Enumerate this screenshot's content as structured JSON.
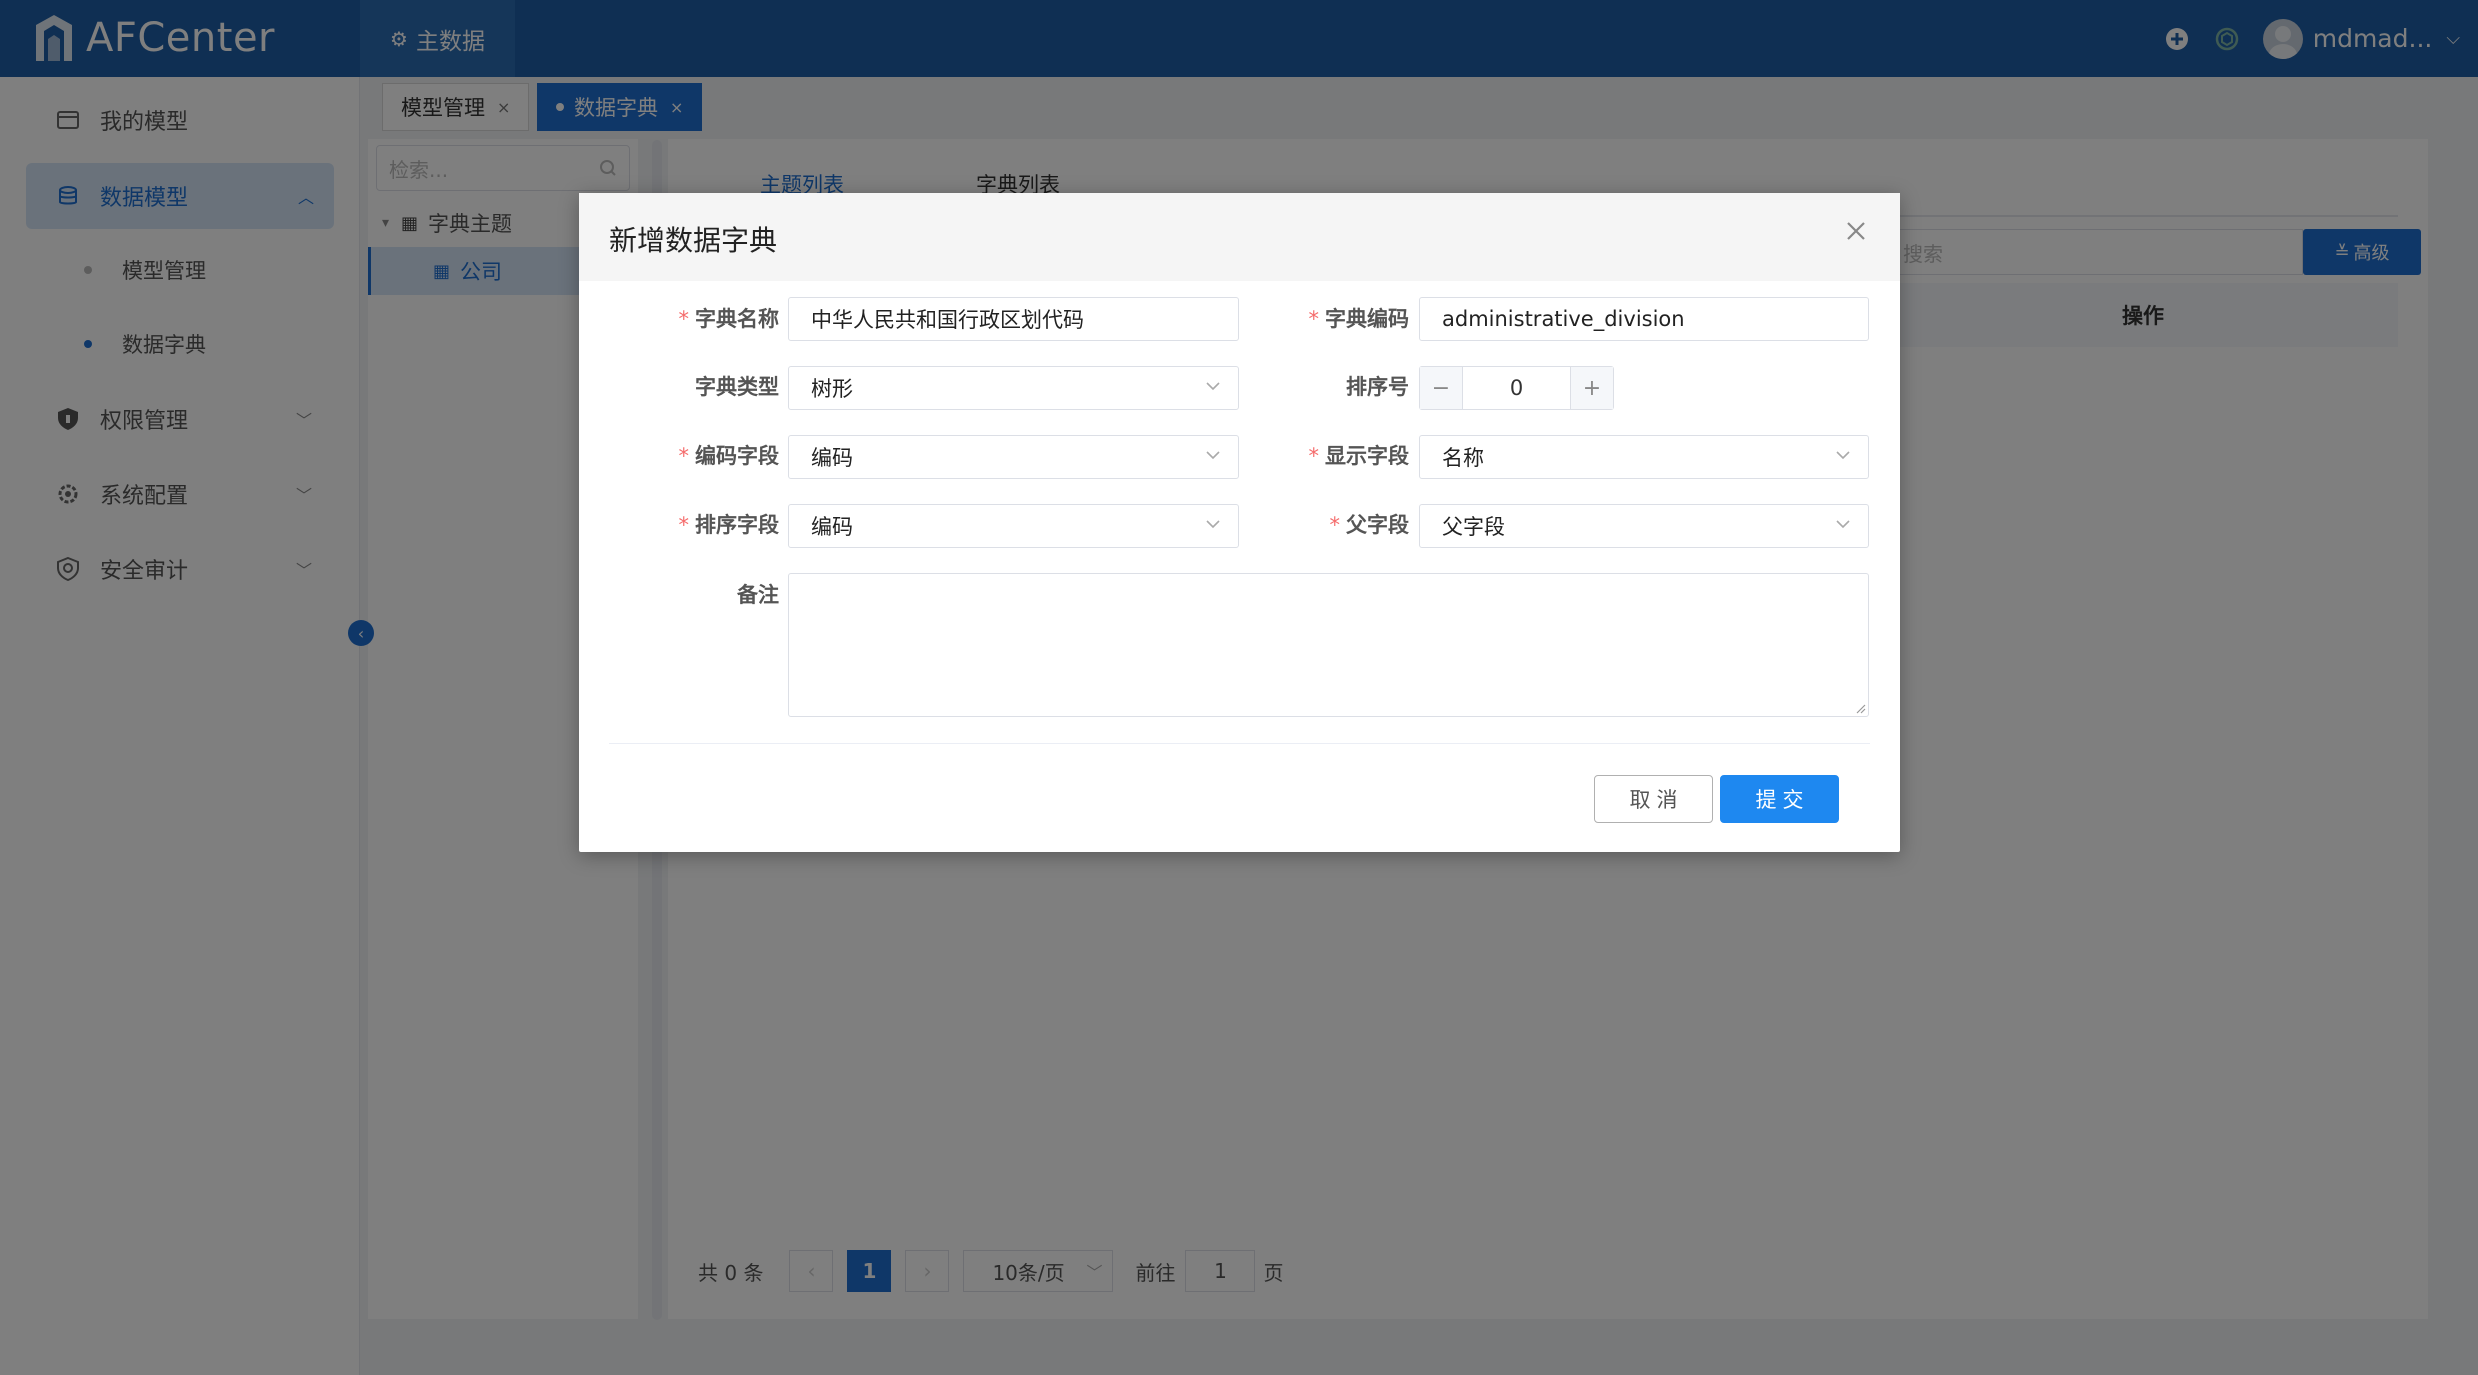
{
  "app": {
    "logo_text": "AFCenter",
    "top_nav_label": "主数据",
    "username": "mdmad..."
  },
  "sidebar": {
    "items": [
      {
        "label": "我的模型"
      },
      {
        "label": "数据模型"
      },
      {
        "label": "权限管理"
      },
      {
        "label": "系统配置"
      },
      {
        "label": "安全审计"
      }
    ],
    "subitems": [
      {
        "label": "模型管理"
      },
      {
        "label": "数据字典"
      }
    ]
  },
  "tabs": [
    {
      "label": "模型管理",
      "close": "×"
    },
    {
      "label": "数据字典",
      "close": "×"
    }
  ],
  "tree": {
    "search_placeholder": "检索...",
    "nodes": [
      {
        "label": "字典主题"
      },
      {
        "label": "公司"
      }
    ]
  },
  "main": {
    "tabs": [
      {
        "label": "主题列表"
      },
      {
        "label": "字典列表"
      }
    ],
    "search_placeholder": "搜索",
    "advanced_label": "高级",
    "column_operation": "操作",
    "pager": {
      "total": "共 0 条",
      "current_page": "1",
      "page_size": "10条/页",
      "goto_prefix": "前往",
      "goto_value": "1",
      "goto_suffix": "页"
    }
  },
  "modal": {
    "title": "新增数据字典",
    "fields": {
      "dict_name": {
        "label": "字典名称",
        "value": "中华人民共和国行政区划代码"
      },
      "dict_code": {
        "label": "字典编码",
        "value": "administrative_division"
      },
      "dict_type": {
        "label": "字典类型",
        "value": "树形"
      },
      "sort_no": {
        "label": "排序号",
        "value": "0",
        "minus": "−",
        "plus": "+"
      },
      "code_field": {
        "label": "编码字段",
        "value": "编码"
      },
      "display_field": {
        "label": "显示字段",
        "value": "名称"
      },
      "sort_field": {
        "label": "排序字段",
        "value": "编码"
      },
      "parent_field": {
        "label": "父字段",
        "value": "父字段"
      },
      "remark": {
        "label": "备注",
        "value": ""
      }
    },
    "cancel_label": "取消",
    "submit_label": "提交",
    "required_mark": "*"
  },
  "colors": {
    "header": "#1e5fa6",
    "accent": "#1e6fd1",
    "required": "#f56c6c"
  }
}
